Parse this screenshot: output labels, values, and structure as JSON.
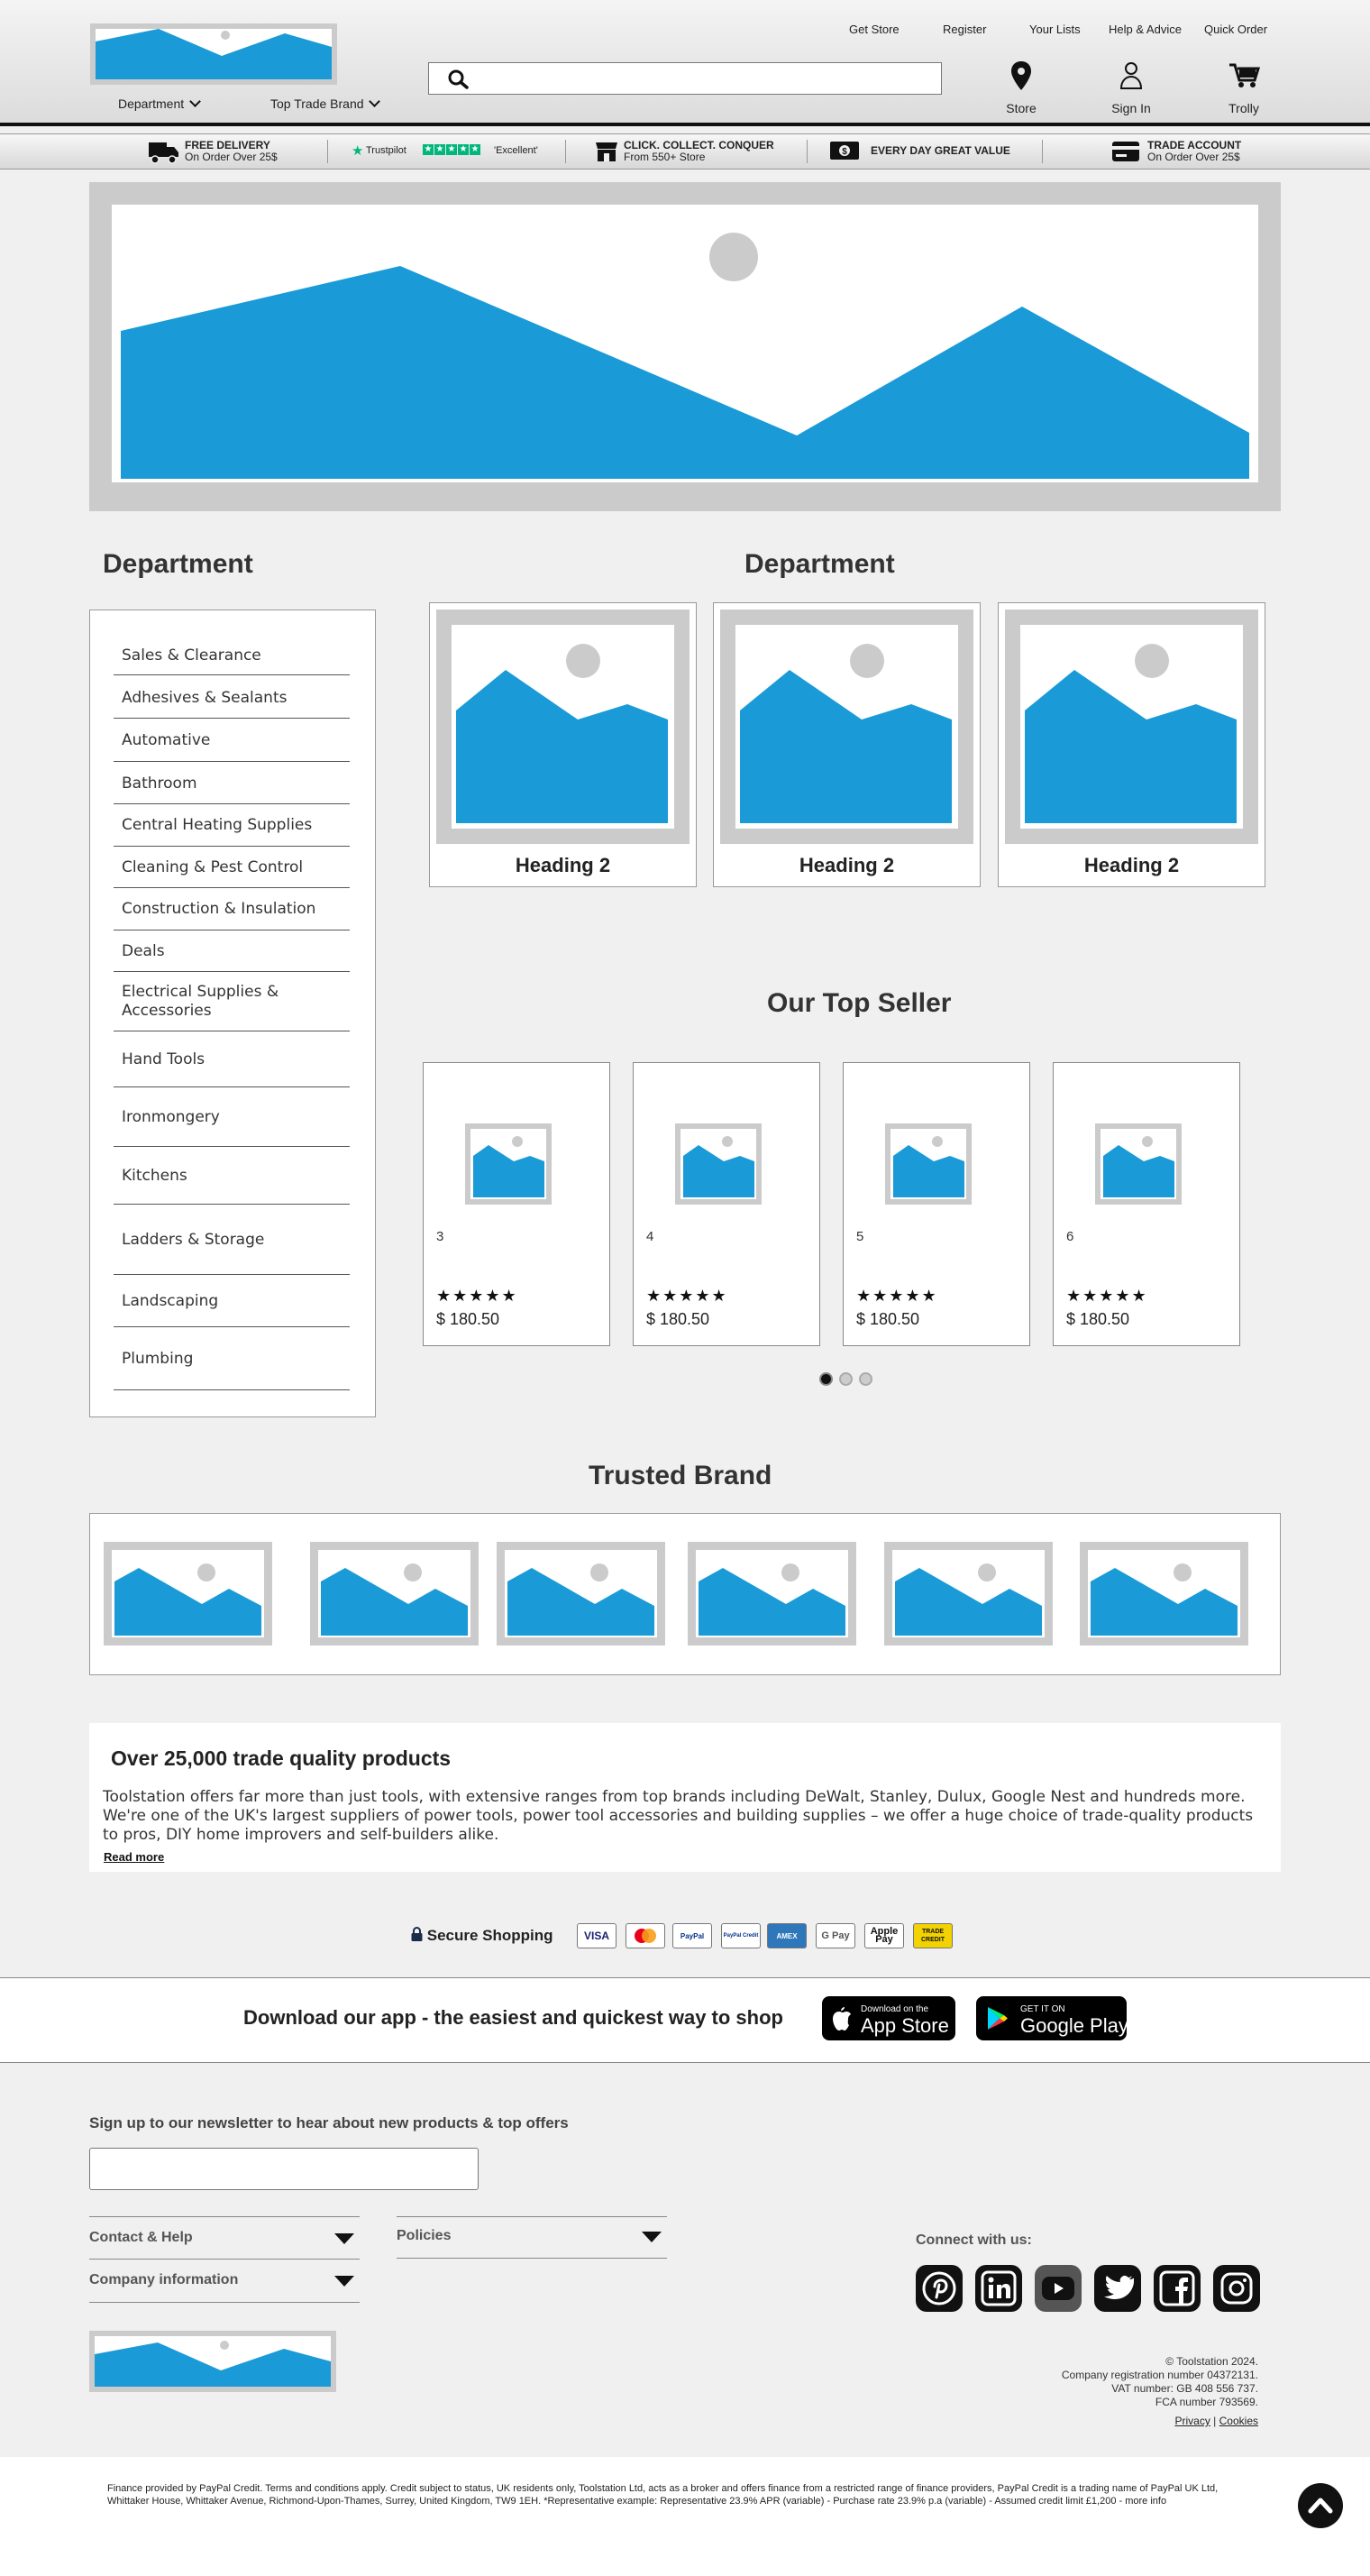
{
  "header": {
    "top_links": [
      "Get Store",
      "Register",
      "Your Lists",
      "Help & Advice",
      "Quick Order"
    ],
    "nav": [
      "Department",
      "Top Trade Brand"
    ],
    "search": {
      "placeholder": "",
      "value": ""
    },
    "icons": [
      {
        "label": "Store",
        "icon": "map-pin-icon"
      },
      {
        "label": "Sign In",
        "icon": "user-icon"
      },
      {
        "label": "Trolly",
        "icon": "cart-icon"
      }
    ]
  },
  "usp": {
    "delivery": {
      "title": "FREE DELIVERY",
      "sub": "On Order Over 25$"
    },
    "trustpilot": {
      "brand": "Trustpilot",
      "rating": "'Excellent'"
    },
    "click_collect": {
      "title": "CLICK. COLLECT. CONQUER",
      "sub": "From 550+ Store"
    },
    "value": {
      "title": "EVERY DAY GREAT VALUE"
    },
    "trade": {
      "title": "TRADE ACCOUNT",
      "sub": "On Order Over 25$"
    }
  },
  "departments": {
    "title": "Department",
    "items": [
      "Sales & Clearance",
      "Adhesives & Sealants",
      "Automative",
      "Bathroom",
      "Central Heating Supplies",
      "Cleaning & Pest Control",
      "Construction & Insulation",
      "Deals",
      "Electrical Supplies & Accessories",
      "Hand Tools",
      "Ironmongery",
      "Kitchens",
      "Ladders & Storage",
      "Landscaping",
      "Plumbing"
    ]
  },
  "featured": {
    "title": "Department",
    "cards": [
      "Heading 2",
      "Heading 2",
      "Heading 2"
    ]
  },
  "top_seller": {
    "title": "Our Top Seller",
    "products": [
      {
        "name": "3",
        "rating": 5,
        "price": "$ 180.50"
      },
      {
        "name": "4",
        "rating": 5,
        "price": "$ 180.50"
      },
      {
        "name": "5",
        "rating": 5,
        "price": "$ 180.50"
      },
      {
        "name": "6",
        "rating": 5,
        "price": "$ 180.50"
      }
    ],
    "slide_count": 3,
    "active_slide": 0
  },
  "brands": {
    "title": "Trusted Brand"
  },
  "about": {
    "title": "Over 25,000 trade quality products",
    "body": "Toolstation offers far more than just tools, with extensive ranges from top brands including DeWalt, Stanley, Dulux, Google Nest and hundreds more. We're one of the UK's largest suppliers of power tools, power tool accessories and building supplies – we offer a huge choice of trade-quality products to pros, DIY home improvers and self-builders alike.",
    "read_more": "Read more"
  },
  "secure": {
    "label": "Secure Shopping",
    "methods": [
      "VISA",
      "Mastercard",
      "PayPal",
      "PayPal Credit",
      "AMEX",
      "G Pay",
      "Apple Pay",
      "TRADE CREDIT"
    ]
  },
  "app": {
    "text": "Download our app - the easiest and quickest way to shop",
    "app_store": {
      "small": "Download on the",
      "big": "App Store"
    },
    "google_play": {
      "small": "GET IT ON",
      "big": "Google Play"
    }
  },
  "footer": {
    "newsletter_label": "Sign up to our newsletter to hear about new products & top offers",
    "newsletter_placeholder": "",
    "accordions": [
      "Contact & Help",
      "Company information",
      "Policies"
    ],
    "connect_label": "Connect with us:",
    "social": [
      "pinterest-icon",
      "linkedin-icon",
      "youtube-icon",
      "twitter-icon",
      "facebook-icon",
      "instagram-icon"
    ],
    "legal": [
      "© Toolstation 2024.",
      "Company registration number 04372131.",
      "VAT number: GB 408 556 737.",
      "FCA number 793569."
    ],
    "privacy": "Privacy",
    "divider": "|",
    "cookies": "Cookies"
  },
  "finance_text": "Finance provided by PayPal Credit. Terms and conditions apply. Credit subject to status, UK residents only, Toolstation Ltd, acts as a broker and offers finance from a restricted range of finance providers, PayPal Credit is a trading name of PayPal UK Ltd, Whittaker House, Whittaker Avenue, Richmond-Upon-Thames, Surrey, United Kingdom, TW9 1EH. *Representative example: Representative 23.9% APR (variable) - Purchase rate 23.9% p.a (variable) - Assumed credit limit £1,200 - more info",
  "colors": {
    "accent": "#1a9ad6",
    "placeholder_frame": "#cbcbcb",
    "trustpilot": "#00b67a",
    "trade_credit": "#f2d200"
  }
}
